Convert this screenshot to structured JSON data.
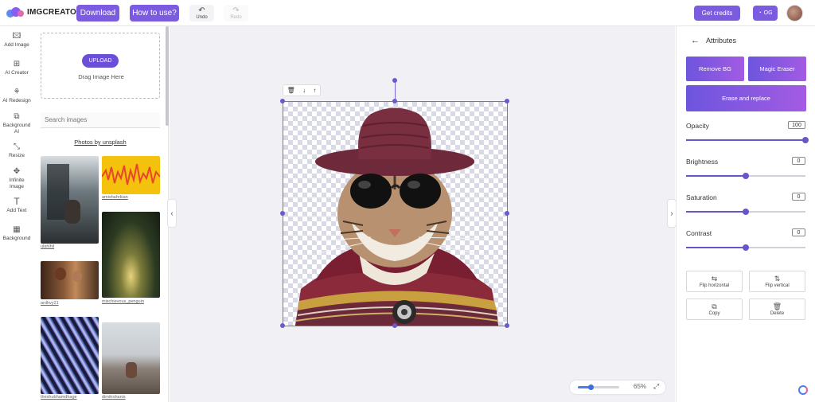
{
  "brand": {
    "name": "IMGCREATOR",
    "colors": {
      "primary": "#7b5ce0",
      "accent_gradient_start": "#6d55de",
      "accent_gradient_end": "#a35be2"
    }
  },
  "topbar": {
    "download_label": "Download",
    "how_to_label": "How to use?",
    "undo_label": "Undo",
    "redo_label": "Redo",
    "get_credits_label": "Get credits",
    "credits_count": "OG"
  },
  "rail": [
    {
      "label": "Add Image",
      "icon": "image-add-icon"
    },
    {
      "label": "AI Creator",
      "icon": "plus-square-icon"
    },
    {
      "label": "AI Redesign",
      "icon": "wand-icon"
    },
    {
      "label": "Background AI",
      "icon": "layers-icon"
    },
    {
      "label": "Resize",
      "icon": "resize-icon"
    },
    {
      "label": "Infinite Image",
      "icon": "move-icon"
    },
    {
      "label": "Add Text",
      "icon": "text-icon"
    },
    {
      "label": "Background",
      "icon": "pattern-icon"
    }
  ],
  "panel": {
    "upload_label": "UPLOAD",
    "drag_text": "Drag Image Here",
    "search_placeholder": "Search images",
    "photos_by": "Photos by unsplash",
    "thumbs": [
      {
        "caption": "ulahlhil"
      },
      {
        "caption": "amishahrkian"
      },
      {
        "caption": "ardhvy21"
      },
      {
        "caption": "mischievous_penguin"
      },
      {
        "caption": "theshubhamdhage"
      },
      {
        "caption": "dimitrohanis"
      }
    ]
  },
  "canvas": {
    "zoom_value": "65%",
    "zoom_fraction": 0.3
  },
  "attributes": {
    "title": "Attributes",
    "remove_bg": "Remove BG",
    "magic_eraser": "Magic Eraser",
    "erase_replace": "Erase and replace",
    "sliders": [
      {
        "label": "Opacity",
        "value": "100",
        "fraction": 1.0
      },
      {
        "label": "Brightness",
        "value": "0",
        "fraction": 0.5
      },
      {
        "label": "Saturation",
        "value": "0",
        "fraction": 0.5
      },
      {
        "label": "Contrast",
        "value": "0",
        "fraction": 0.5
      }
    ],
    "flip_horizontal": "Flip horizontal",
    "flip_vertical": "Flip vertical",
    "copy": "Copy",
    "delete": "Delete"
  }
}
